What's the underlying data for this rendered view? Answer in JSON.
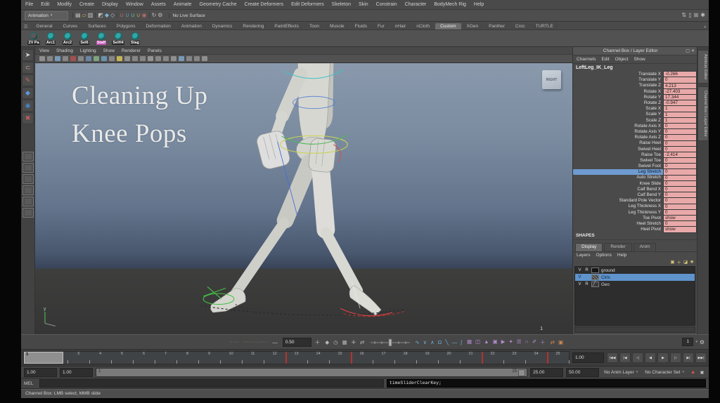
{
  "menu_bar": {
    "items": [
      "File",
      "Edit",
      "Modify",
      "Create",
      "Display",
      "Window",
      "Assets",
      "Animate",
      "Geometry Cache",
      "Create Deformers",
      "Edit Deformers",
      "Skeleton",
      "Skin",
      "Constrain",
      "Character",
      "BodyMech Rig",
      "Help"
    ]
  },
  "status_line": {
    "mode_selector": "Animation",
    "no_live_surface_label": "No Live Surface",
    "icon_groups": [
      {
        "name": "file-ops",
        "icons": [
          {
            "name": "new-scene-icon",
            "glyph": "▤",
            "color": "#c9c9c9"
          },
          {
            "name": "open-scene-icon",
            "glyph": "▱",
            "color": "#d8b860"
          },
          {
            "name": "save-scene-icon",
            "glyph": "▥",
            "color": "#c9c9c9"
          }
        ]
      },
      {
        "name": "selection-masks",
        "icons": [
          {
            "name": "select-hierarchy-icon",
            "glyph": "◩",
            "color": "#bdbdbd"
          },
          {
            "name": "select-object-icon",
            "glyph": "◆",
            "color": "#78b4d8"
          },
          {
            "name": "select-component-icon",
            "glyph": "◇",
            "color": "#bdbdbd"
          }
        ]
      },
      {
        "name": "snapping",
        "icons": [
          {
            "name": "snap-grid-icon",
            "glyph": "∪",
            "color": "#c06a6a"
          },
          {
            "name": "snap-curve-icon",
            "glyph": "∪",
            "color": "#6a9ac0"
          },
          {
            "name": "snap-point-icon",
            "glyph": "∪",
            "color": "#6ac0a0"
          },
          {
            "name": "snap-surface-icon",
            "glyph": "∪",
            "color": "#c0a06a"
          },
          {
            "name": "make-live-icon",
            "glyph": "◉",
            "color": "#b06a6a"
          }
        ]
      },
      {
        "name": "history",
        "icons": [
          {
            "name": "construction-history-icon",
            "glyph": "↻",
            "color": "#bdbdbd"
          },
          {
            "name": "render-settings-icon",
            "glyph": "⚙",
            "color": "#bdbdbd"
          }
        ]
      }
    ],
    "right_icons": [
      {
        "name": "sort-icon",
        "glyph": "⇅",
        "color": "#c0c0c0"
      },
      {
        "name": "bookmark-icon",
        "glyph": "▯",
        "color": "#c0c0c0"
      },
      {
        "name": "grid-layout-icon",
        "glyph": "⊞",
        "color": "#c0c0c0"
      },
      {
        "name": "toolbox-toggle-icon",
        "glyph": "✱",
        "color": "#c0c0c0"
      }
    ]
  },
  "shelf": {
    "tabs": [
      "General",
      "Curves",
      "Surfaces",
      "Polygons",
      "Deformation",
      "Animation",
      "Dynamics",
      "Rendering",
      "PaintEffects",
      "Toon",
      "Muscle",
      "Fluids",
      "Fur",
      "nHair",
      "nCloth",
      "Custom",
      "XGen",
      "Panther",
      "Croc",
      "TURTLE"
    ],
    "active_tab": "Custom",
    "items": [
      {
        "label": "ZV Pa",
        "icon_color": "#5a5a5a"
      },
      {
        "label": "Arc1",
        "icon_color": "#2fa8a8"
      },
      {
        "label": "Arc2",
        "icon_color": "#2fa8a8"
      },
      {
        "label": "Sel6",
        "icon_color": "#2fa8a8"
      },
      {
        "label": "Staff",
        "icon_color": "#2fa8a8",
        "badge_color": "#c050b0"
      },
      {
        "label": "SelH4",
        "icon_color": "#2fa8a8"
      },
      {
        "label": "Stag",
        "icon_color": "#2fa8a8"
      }
    ]
  },
  "toolbox": {
    "tools": [
      {
        "name": "select-tool-icon",
        "glyph": "➤",
        "color": "#d8d8d8"
      },
      {
        "name": "lasso-tool-icon",
        "glyph": "⊂",
        "color": "#d8a0a0"
      },
      {
        "name": "paint-select-tool-icon",
        "glyph": "✎",
        "color": "#c86a5a"
      },
      {
        "name": "move-tool-icon",
        "glyph": "◆",
        "color": "#5a9ad8"
      },
      {
        "name": "rotate-tool-icon",
        "glyph": "◉",
        "color": "#4a86c8"
      },
      {
        "name": "scale-tool-icon",
        "glyph": "✖",
        "color": "#c85a5a"
      }
    ],
    "layout_button_count": 6
  },
  "viewport": {
    "menus": [
      "View",
      "Shading",
      "Lighting",
      "Show",
      "Renderer",
      "Panels"
    ],
    "toolbar_icon_colors": [
      "#9a9a9a",
      "#8f8f8f",
      "#7fa7c9",
      "#8f8f8f",
      "#b05050",
      "#8f8f8f",
      "#6f8fb0",
      "#87b087",
      "#6f9fc0",
      "#8f8f8f",
      "#d8c858",
      "#9a9a9a",
      "#8f8f8f",
      "#8f8f8f",
      "#9f9f9f",
      "#8f8f8f",
      "#8f8f8f",
      "#9a9a9a",
      "#7fa7c9",
      "#8f8f8f",
      "#8f8f8f",
      "#9a9a9a"
    ],
    "overlay_title_line1": "Cleaning Up",
    "overlay_title_line2": "Knee Pops",
    "view_cube_label": "RIGHT",
    "frame_readout": "1"
  },
  "channel_box": {
    "title": "Channel Box / Layer Editor",
    "header_icons": [
      {
        "name": "copy-tab-icon",
        "glyph": "▢"
      },
      {
        "name": "close-icon",
        "glyph": "✕"
      }
    ],
    "tool_icons": [
      {
        "name": "speed-slider-icon",
        "glyph": "⌖"
      },
      {
        "name": "hyperbolic-icon",
        "glyph": "◐"
      },
      {
        "name": "edit-mode-icon",
        "glyph": "✎"
      }
    ],
    "menus": [
      "Channels",
      "Edit",
      "Object",
      "Show"
    ],
    "object_name": "LeftLeg_IK_Leg",
    "value_field_color": "#e9a9a9",
    "selected_row_color": "#6e9bd1",
    "channels": [
      {
        "label": "Translate X",
        "value": "-0.266"
      },
      {
        "label": "Translate Y",
        "value": "0"
      },
      {
        "label": "Translate Z",
        "value": "4.213"
      },
      {
        "label": "Rotate X",
        "value": "-27.403"
      },
      {
        "label": "Rotate Y",
        "value": "17.344"
      },
      {
        "label": "Rotate Z",
        "value": "-0.947"
      },
      {
        "label": "Scale X",
        "value": "1"
      },
      {
        "label": "Scale Y",
        "value": "1"
      },
      {
        "label": "Scale Z",
        "value": "1"
      },
      {
        "label": "Rotate Axis X",
        "value": "0"
      },
      {
        "label": "Rotate Axis Y",
        "value": "0"
      },
      {
        "label": "Rotate Axis Z",
        "value": "0"
      },
      {
        "label": "Raise Heel",
        "value": "0"
      },
      {
        "label": "Swivel Heel",
        "value": "0"
      },
      {
        "label": "Raise Toe",
        "value": "-2.414"
      },
      {
        "label": "Swivel Toe",
        "value": "0"
      },
      {
        "label": "Swivel Foot",
        "value": "0"
      },
      {
        "label": "Leg Stretch",
        "value": "0",
        "selected": true
      },
      {
        "label": "Auto Stretch",
        "value": "0"
      },
      {
        "label": "Knee Slide",
        "value": "0"
      },
      {
        "label": "Calf Bend X",
        "value": "0"
      },
      {
        "label": "Calf Bend Y",
        "value": "0"
      },
      {
        "label": "Standard Pole Vector",
        "value": "0"
      },
      {
        "label": "Leg Thickness X",
        "value": "0"
      },
      {
        "label": "Leg Thickness Y",
        "value": "0"
      },
      {
        "label": "Toe Pivot",
        "value": "show"
      },
      {
        "label": "Heel Stretch",
        "value": "0"
      },
      {
        "label": "Heel Pivot",
        "value": "show"
      }
    ],
    "shapes_label": "SHAPES"
  },
  "layer_editor": {
    "tabs": [
      "Display",
      "Render",
      "Anim"
    ],
    "active_tab": "Display",
    "menus": [
      "Layers",
      "Options",
      "Help"
    ],
    "toolbar_icons": [
      {
        "name": "move-layer-icon",
        "glyph": "▣"
      },
      {
        "name": "empty-layer-icon",
        "glyph": "＋"
      },
      {
        "name": "new-layer-icon",
        "glyph": "◪"
      },
      {
        "name": "new-layer-selected-icon",
        "glyph": "❖"
      }
    ],
    "layers": [
      {
        "visible": "V",
        "renderable": "R",
        "swatch": "solid",
        "name": "ground",
        "selected": false
      },
      {
        "visible": "V",
        "renderable": "",
        "swatch": "hatch",
        "name": "Ctrls",
        "selected": true
      },
      {
        "visible": "V",
        "renderable": "R",
        "swatch": "wire",
        "name": "Geo",
        "selected": false
      }
    ]
  },
  "side_tabs": [
    {
      "label": "Attribute Editor"
    },
    {
      "label": "Channel Box / Layer Editor"
    }
  ],
  "anim_toolbar": {
    "key_display_a": "·.·.·",
    "key_display_b": "·.·.·.·.·.·.·",
    "minus_label": "—",
    "tween_value": "0.50",
    "plus_label": "＋",
    "tool_icons": [
      {
        "name": "set-key-icon",
        "glyph": "◆",
        "color": "#b8b8b8"
      },
      {
        "name": "clock-icon",
        "glyph": "◷",
        "color": "#b8b8b8"
      },
      {
        "name": "grid-icon",
        "glyph": "▦",
        "color": "#b8b8b8"
      },
      {
        "name": "align-icon",
        "glyph": "✛",
        "color": "#b8b8b8"
      },
      {
        "name": "swap-icon",
        "glyph": "⇄",
        "color": "#b8b8b8"
      }
    ],
    "curve_icons": {
      "color": "#6fb4dc",
      "glyphs": [
        "∿",
        "∨",
        "∧",
        "Ω",
        "╲",
        "—",
        "ʃ"
      ]
    },
    "utility_icons": {
      "color": "#b48ad0",
      "glyphs": [
        "▦",
        "◫",
        "▲",
        "▣",
        "▶",
        "✦",
        "☰",
        "∩",
        "✐",
        "＋"
      ]
    },
    "extra_icons": {
      "color": "#d08a50",
      "glyphs": [
        "⇄",
        "▣"
      ]
    },
    "frame_step_value": "1",
    "dropdown_arrow": "▾",
    "gear_glyph": "⚙"
  },
  "time_slider": {
    "frames_start": 1,
    "frames_end": 25,
    "current_frame": "1",
    "key_frames": [
      13,
      16,
      22,
      25
    ],
    "key_color": "#b43230",
    "rate_field": "1.00",
    "playback_buttons": [
      "|◀◀",
      "|◀",
      "◁",
      "◀",
      "▶",
      "▷",
      "▶|",
      "▶▶|"
    ]
  },
  "range_slider": {
    "anim_start_field": "1.00",
    "playback_start_field": "1.00",
    "bar_start_label": "1",
    "bar_end_label": "25",
    "playback_end_field": "25.00",
    "anim_end_field": "50.00",
    "anim_layer_selector": "No Anim Layer",
    "character_set_selector": "No Character Set",
    "end_icons": [
      {
        "name": "auto-keyframe-icon",
        "glyph": "◆",
        "color": "#d05050"
      },
      {
        "name": "animation-preferences-icon",
        "glyph": "▣",
        "color": "#c0c0c0"
      }
    ]
  },
  "command_line": {
    "label": "MEL",
    "input_value": "",
    "result_value": "timeSliderClearKey;"
  },
  "help_line": {
    "text": "Channel Box: LMB select, MMB slide"
  }
}
